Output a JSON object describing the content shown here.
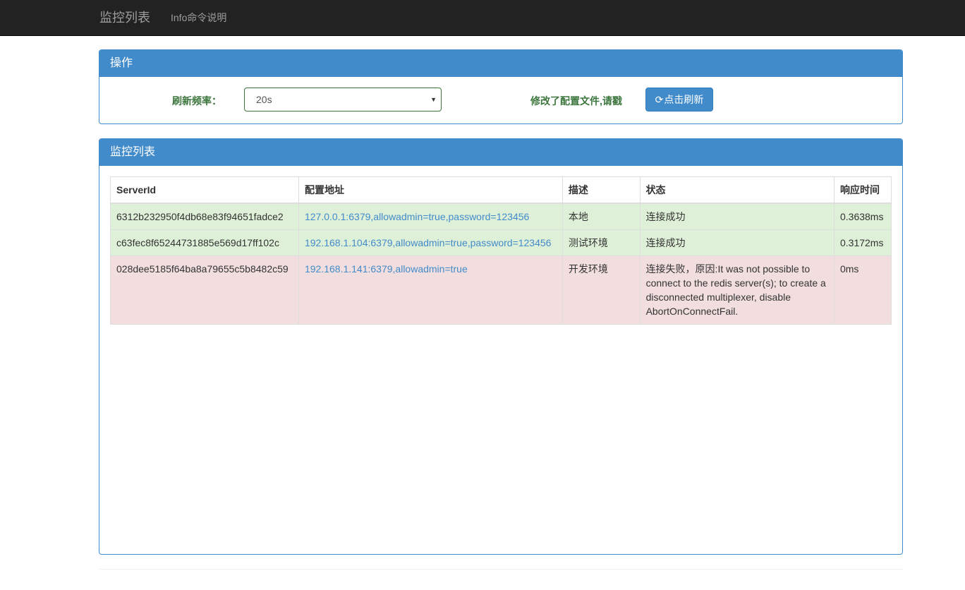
{
  "navbar": {
    "brand": "监控列表",
    "link": "Info命令说明"
  },
  "ops_panel": {
    "title": "操作",
    "rate_label": "刷新频率：",
    "rate_value": "20s",
    "message": "修改了配置文件,请戳",
    "refresh_label": "点击刷新"
  },
  "list_panel": {
    "title": "监控列表",
    "headers": [
      "ServerId",
      "配置地址",
      "描述",
      "状态",
      "响应时间"
    ],
    "rows": [
      {
        "status_type": "success",
        "server_id": "6312b232950f4db68e83f94651fadce2",
        "address": "127.0.0.1:6379,allowadmin=true,password=123456",
        "desc": "本地",
        "status": "连接成功",
        "time": "0.3638ms"
      },
      {
        "status_type": "success",
        "server_id": "c63fec8f65244731885e569d17ff102c",
        "address": "192.168.1.104:6379,allowadmin=true,password=123456",
        "desc": "测试环境",
        "status": "连接成功",
        "time": "0.3172ms"
      },
      {
        "status_type": "danger",
        "server_id": "028dee5185f64ba8a79655c5b8482c59",
        "address": "192.168.1.141:6379,allowadmin=true",
        "desc": "开发环境",
        "status": "连接失败，原因:It was not possible to connect to the redis server(s); to create a disconnected multiplexer, disable AbortOnConnectFail.",
        "time": "0ms"
      }
    ]
  },
  "colors": {
    "primary": "#428bca",
    "success_bg": "#dff0d8",
    "danger_bg": "#f2dede",
    "success_text": "#3c763d",
    "navbar": "#222222"
  },
  "icons": {
    "refresh": "refresh-icon",
    "select_caret": "caret-down-icon"
  }
}
